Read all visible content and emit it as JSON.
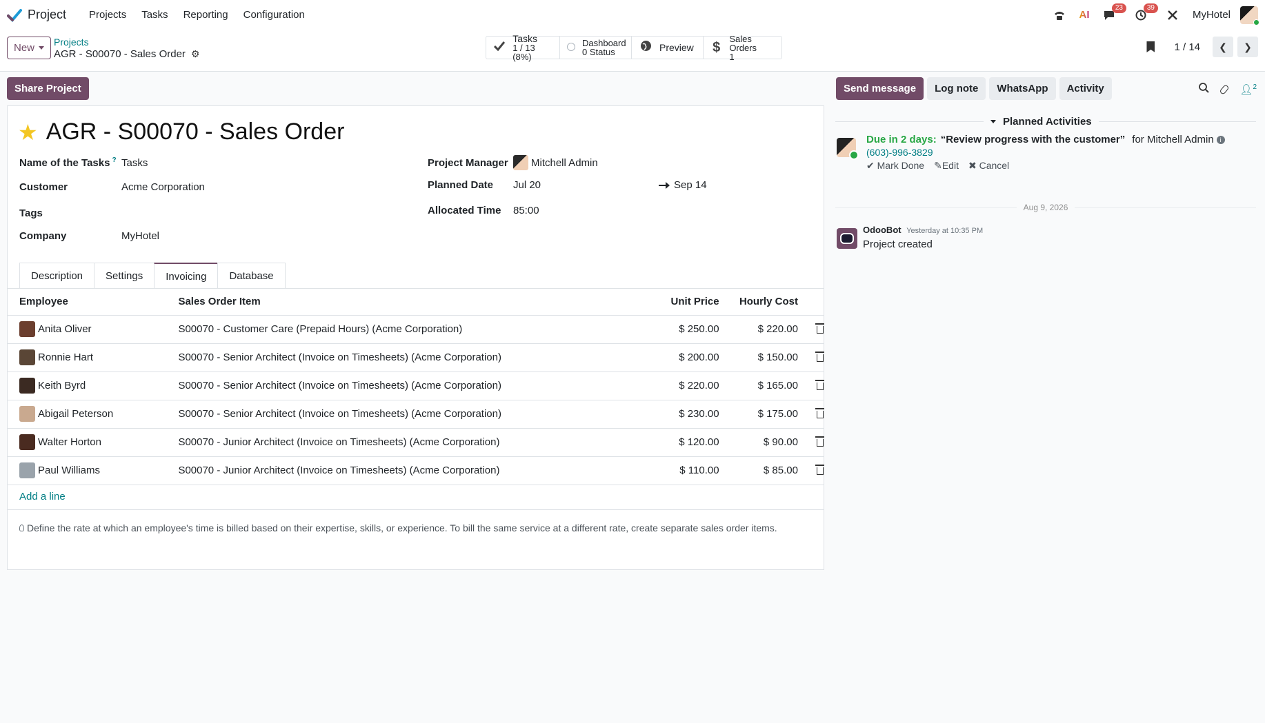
{
  "navbar": {
    "app_name": "Project",
    "menu": [
      "Projects",
      "Tasks",
      "Reporting",
      "Configuration"
    ],
    "messages_badge": "23",
    "activities_badge": "39",
    "ai_label": "AI",
    "company": "MyHotel"
  },
  "control_panel": {
    "new_label": "New",
    "breadcrumb_parent": "Projects",
    "breadcrumb_current": "AGR - S00070 - Sales Order",
    "smart_buttons": [
      {
        "title": "Tasks",
        "subtitle": "1 / 13 (8%)",
        "icon": "check-icon"
      },
      {
        "title": "Dashboard",
        "subtitle": "0 Status",
        "icon": "radio-icon"
      },
      {
        "title": "Preview",
        "subtitle": "",
        "icon": "globe-icon"
      },
      {
        "title": "Sales Orders",
        "subtitle": "1",
        "icon": "dollar-icon"
      }
    ],
    "pager": "1 / 14"
  },
  "form": {
    "share_label": "Share Project",
    "title": "AGR - S00070 - Sales Order",
    "fields": {
      "tasks_label": "Name of the Tasks",
      "tasks_help": "?",
      "tasks_value": "Tasks",
      "customer_label": "Customer",
      "customer_value": "Acme Corporation",
      "tags_label": "Tags",
      "company_label": "Company",
      "company_value": "MyHotel",
      "manager_label": "Project Manager",
      "manager_value": "Mitchell Admin",
      "planned_label": "Planned Date",
      "planned_start": "Jul 20",
      "planned_end": "Sep 14",
      "allocated_label": "Allocated Time",
      "allocated_value": "85:00"
    },
    "tabs": [
      "Description",
      "Settings",
      "Invoicing",
      "Database"
    ],
    "active_tab": "Invoicing",
    "table": {
      "headers": [
        "Employee",
        "Sales Order Item",
        "Unit Price",
        "Hourly Cost"
      ],
      "rows": [
        {
          "employee": "Anita Oliver",
          "item": "S00070 - Customer Care (Prepaid Hours) (Acme Corporation)",
          "price": "$ 250.00",
          "cost": "$ 220.00",
          "avatar": "#6b3e2e"
        },
        {
          "employee": "Ronnie Hart",
          "item": "S00070 - Senior Architect (Invoice on Timesheets) (Acme Corporation)",
          "price": "$ 200.00",
          "cost": "$ 150.00",
          "avatar": "#5a4636"
        },
        {
          "employee": "Keith Byrd",
          "item": "S00070 - Senior Architect (Invoice on Timesheets) (Acme Corporation)",
          "price": "$ 220.00",
          "cost": "$ 165.00",
          "avatar": "#3b2a22"
        },
        {
          "employee": "Abigail Peterson",
          "item": "S00070 - Senior Architect (Invoice on Timesheets) (Acme Corporation)",
          "price": "$ 230.00",
          "cost": "$ 175.00",
          "avatar": "#c9a98f"
        },
        {
          "employee": "Walter Horton",
          "item": "S00070 - Junior Architect (Invoice on Timesheets) (Acme Corporation)",
          "price": "$ 120.00",
          "cost": "$ 90.00",
          "avatar": "#4a2b20"
        },
        {
          "employee": "Paul Williams",
          "item": "S00070 - Junior Architect (Invoice on Timesheets) (Acme Corporation)",
          "price": "$ 110.00",
          "cost": "$ 85.00",
          "avatar": "#9aa3ab"
        }
      ],
      "add_line": "Add a line"
    },
    "hint": "Define the rate at which an employee's time is billed based on their expertise, skills, or experience. To bill the same service at a different rate, create separate sales order items."
  },
  "chatter": {
    "buttons": [
      "Send message",
      "Log note",
      "WhatsApp",
      "Activity"
    ],
    "followers_count": "2",
    "planned_header": "Planned Activities",
    "activity": {
      "due": "Due in 2 days:",
      "title": "“Review progress with the customer”",
      "for": "for Mitchell Admin",
      "phone": "(603)-996-3829",
      "actions": [
        "Mark Done",
        "Edit",
        "Cancel"
      ]
    },
    "date_separator": "Aug 9, 2026",
    "message": {
      "author": "OdooBot",
      "date": "Yesterday at 10:35 PM",
      "body": "Project created"
    }
  },
  "colors": {
    "primary": "#714b67",
    "link": "#017e84",
    "success": "#28a745",
    "badge": "#d9534f",
    "star": "#f3c623"
  }
}
